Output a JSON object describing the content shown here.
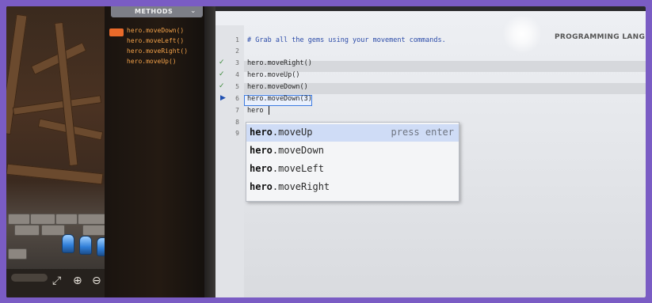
{
  "methods_panel": {
    "title": "METHODS",
    "items": [
      "hero.moveDown()",
      "hero.moveLeft()",
      "hero.moveRight()",
      "hero.moveUp()"
    ]
  },
  "editor": {
    "title": "PROGRAMMING LANGUAG",
    "lines": [
      {
        "number": "1",
        "text": "# Grab all the gems using your movement commands."
      },
      {
        "number": "2",
        "text": ""
      },
      {
        "number": "3",
        "text": "hero.moveRight()"
      },
      {
        "number": "4",
        "text": "hero.moveUp()"
      },
      {
        "number": "5",
        "text": "hero.moveDown()"
      },
      {
        "number": "6",
        "text": "hero.moveDown(3)"
      },
      {
        "number": "7",
        "text": "hero"
      },
      {
        "number": "8",
        "text": ""
      },
      {
        "number": "9",
        "text": ""
      }
    ]
  },
  "autocomplete": {
    "prefix": "hero",
    "hint": "press enter",
    "items": [
      ".moveUp",
      ".moveDown",
      ".moveLeft",
      ".moveRight"
    ]
  },
  "colors": {
    "method_text": "#f3a24a",
    "selection": "#cfdcf6",
    "frame": "#7a5cc4"
  },
  "icons": {
    "expand": "expand-icon",
    "zoom_in": "zoom-in-icon",
    "zoom_out": "zoom-out-icon",
    "check": "check-icon",
    "run": "play-arrow-icon"
  }
}
